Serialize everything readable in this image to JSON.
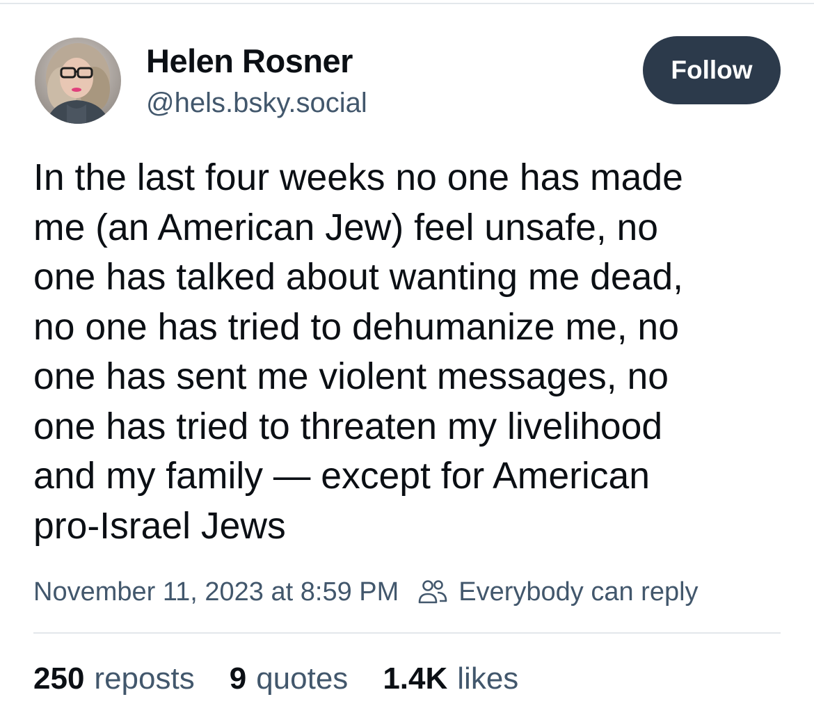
{
  "author": {
    "display_name": "Helen Rosner",
    "handle": "@hels.bsky.social"
  },
  "follow_button": {
    "label": "Follow"
  },
  "post": {
    "text": "In the last four weeks no one has made\nme (an American Jew) feel unsafe, no\none has talked about wanting me dead,\nno one has tried to dehumanize me, no\none has sent me violent messages, no\none has tried to threaten my livelihood\nand my family — except for American\npro-Israel Jews",
    "timestamp": "November 11, 2023 at 8:59 PM",
    "reply_setting": "Everybody can reply"
  },
  "stats": {
    "reposts": {
      "count": "250",
      "label": "reposts"
    },
    "quotes": {
      "count": "9",
      "label": "quotes"
    },
    "likes": {
      "count": "1.4K",
      "label": "likes"
    }
  },
  "icons": {
    "reply_setting_icon": "people-icon"
  },
  "colors": {
    "follow_button_bg": "#2c3a4b",
    "secondary_text": "#42576c",
    "primary_text": "#0b0f14"
  }
}
